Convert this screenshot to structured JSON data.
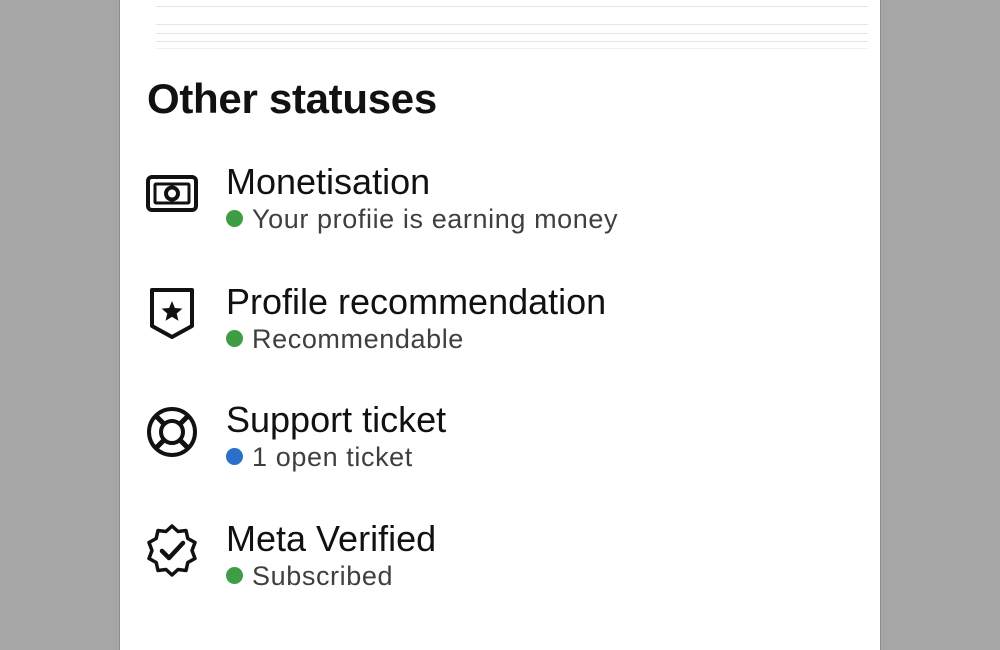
{
  "section": {
    "title": "Other statuses"
  },
  "items": [
    {
      "title": "Monetisation",
      "status": "Your profiie is earning money",
      "icon": "money-icon",
      "dot_color": "#3f9d45"
    },
    {
      "title": "Profile recommendation",
      "status": "Recommendable",
      "icon": "shield-star-icon",
      "dot_color": "#3f9d45"
    },
    {
      "title": "Support ticket",
      "status": "1 open ticket",
      "icon": "lifebuoy-icon",
      "dot_color": "#2a6fc9"
    },
    {
      "title": "Meta Verified",
      "status": "Subscribed",
      "icon": "verified-badge-icon",
      "dot_color": "#3f9d45"
    }
  ]
}
